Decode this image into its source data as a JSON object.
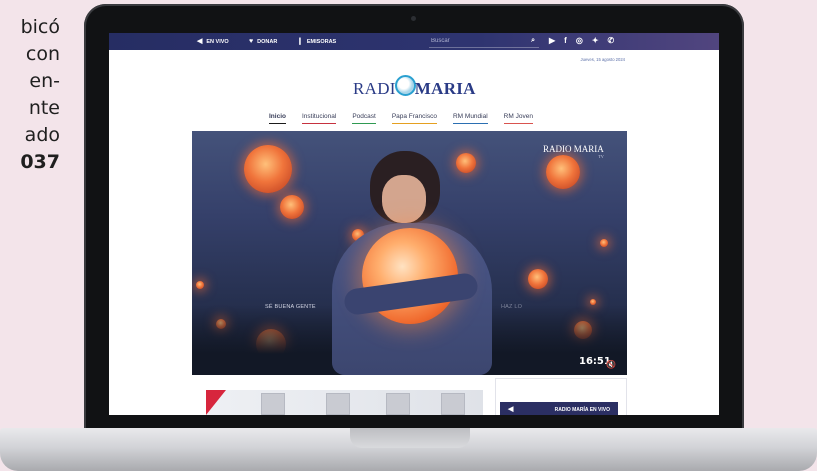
{
  "side_text": [
    "bicó",
    "con",
    "en-",
    "nte",
    "ado",
    "037"
  ],
  "topbar": {
    "en_vivo": "EN VIVO",
    "donar": "DONAR",
    "emisoras": "EMISORAS",
    "search_placeholder": "Buscar",
    "icons": {
      "en_vivo": "speaker-icon",
      "donar": "heart-icon",
      "emisoras": "microphone-icon",
      "search": "search-icon"
    },
    "social_icons": [
      "youtube-icon",
      "facebook-icon",
      "instagram-icon",
      "twitter-icon",
      "whatsapp-icon"
    ]
  },
  "date": "Jueves, 15 agosto 2024",
  "logo": {
    "left": "RADI",
    "right": "MARIA"
  },
  "nav": [
    "Inicio",
    "Institucional",
    "Podcast",
    "Papa Francisco",
    "RM Mundial",
    "RM Joven"
  ],
  "hero": {
    "caption_left": "SÉ BUENA GENTE",
    "caption_right": "HAZ LO",
    "logo": "RADIO MARIA",
    "logo_sub": "TV",
    "time": "16:51"
  },
  "live": {
    "label": "RADIO MARÍA EN VIVO"
  },
  "colors": {
    "topbar": "#262d63",
    "accent": "#2a3b86",
    "live_button": "#2b2f63"
  }
}
